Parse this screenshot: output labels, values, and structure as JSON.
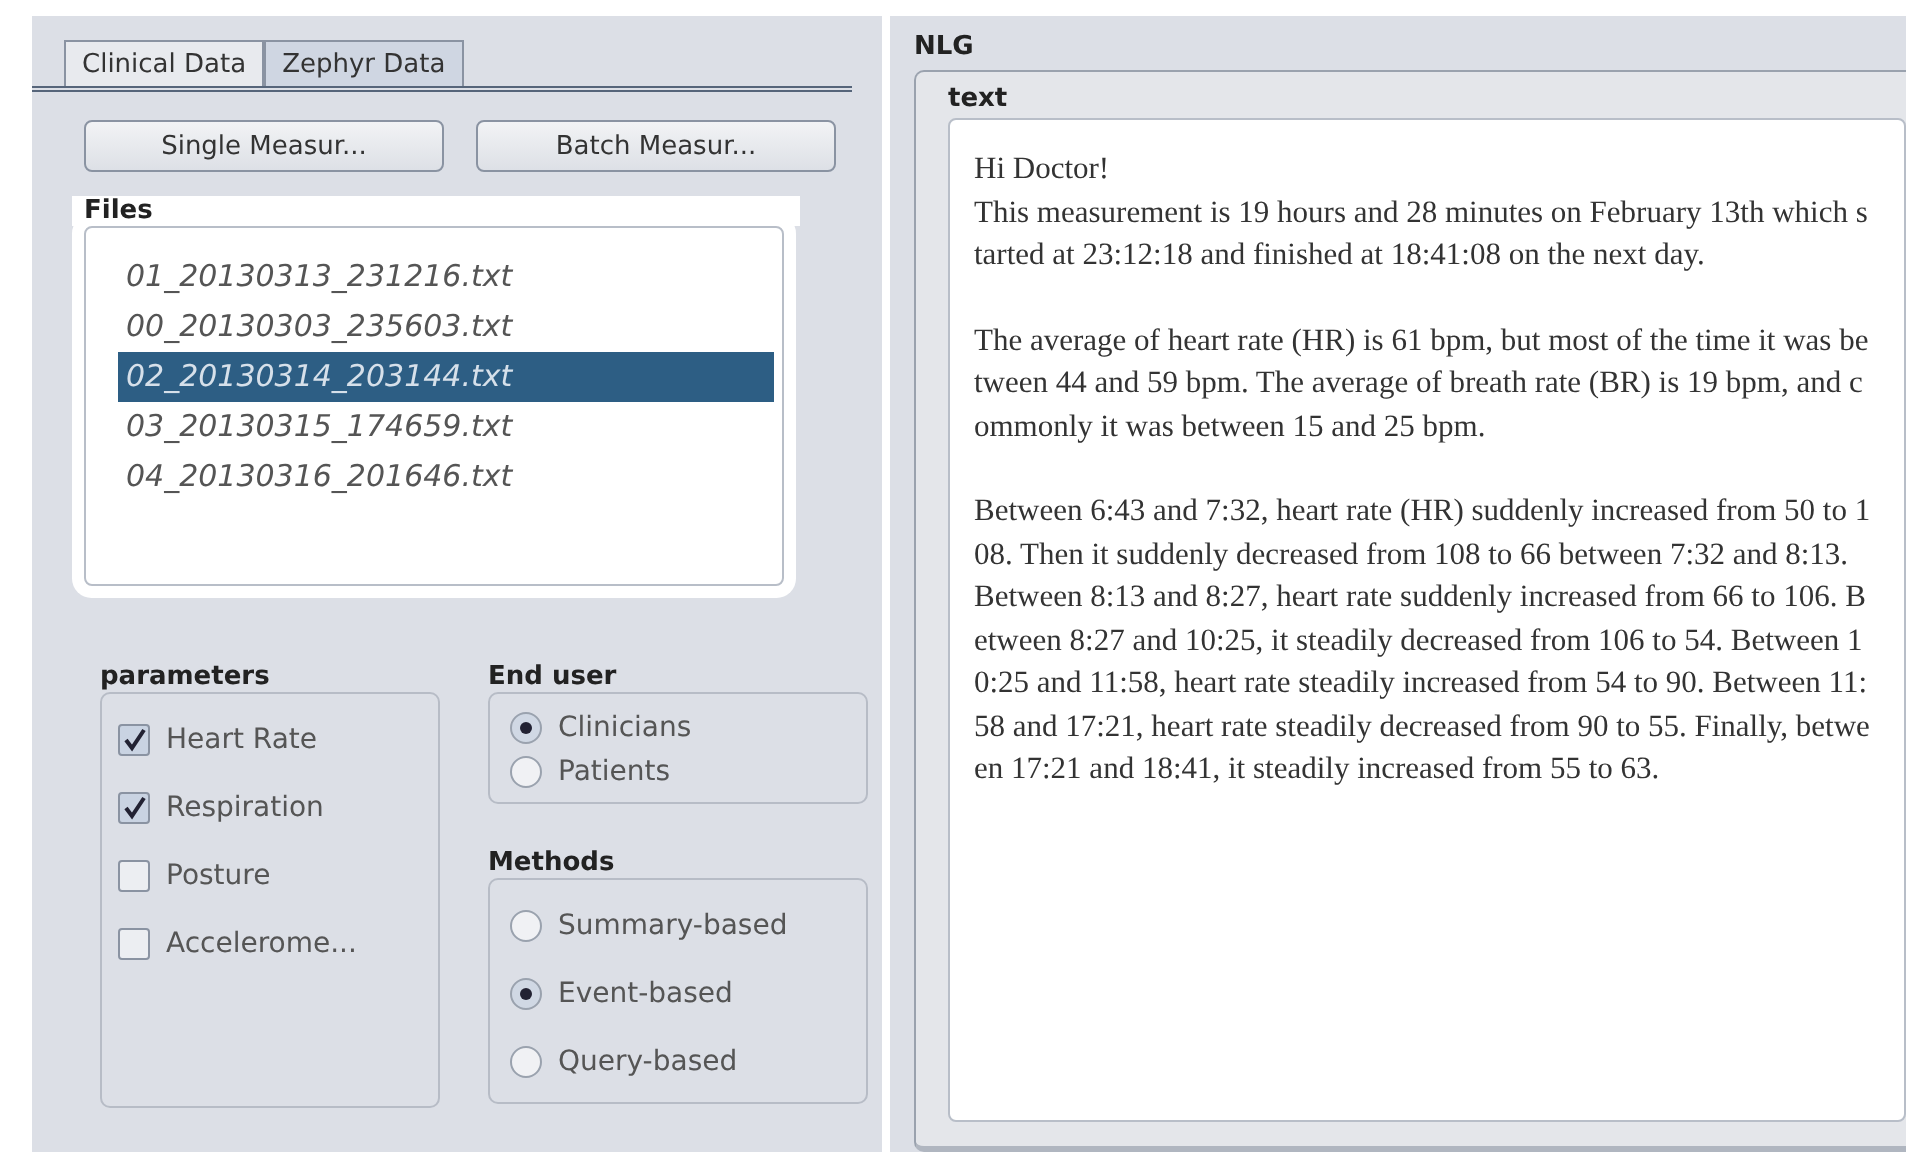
{
  "tabs": [
    {
      "label": "Clinical Data",
      "selected": false
    },
    {
      "label": "Zephyr Data",
      "selected": true
    }
  ],
  "buttons": [
    "Single Measur...",
    "Batch Measur..."
  ],
  "files": {
    "title": "Files",
    "items": [
      {
        "name": "01_20130313_231216.txt",
        "selected": false
      },
      {
        "name": "00_20130303_235603.txt",
        "selected": false
      },
      {
        "name": "02_20130314_203144.txt",
        "selected": true
      },
      {
        "name": "03_20130315_174659.txt",
        "selected": false
      },
      {
        "name": "04_20130316_201646.txt",
        "selected": false
      }
    ]
  },
  "parameters": {
    "title": "parameters",
    "items": [
      {
        "label": "Heart Rate",
        "checked": true
      },
      {
        "label": "Respiration",
        "checked": true
      },
      {
        "label": "Posture",
        "checked": false
      },
      {
        "label": "Accelerome...",
        "checked": false
      }
    ]
  },
  "end_user": {
    "title": "End user",
    "options": [
      {
        "label": "Clinicians",
        "selected": true
      },
      {
        "label": "Patients",
        "selected": false
      }
    ]
  },
  "methods": {
    "title": "Methods",
    "options": [
      {
        "label": "Summary-based",
        "selected": false
      },
      {
        "label": "Event-based",
        "selected": true
      },
      {
        "label": "Query-based",
        "selected": false
      }
    ]
  },
  "nlg": {
    "title": "NLG",
    "text_title": "text",
    "greeting": "Hi Doctor!",
    "paragraphs": [
      "This measurement is 19 hours and 28 minutes on February 13th which started at 23:12:18 and finished at 18:41:08 on the next day.",
      "The average of heart rate (HR) is 61 bpm, but most of the time it was between 44 and 59 bpm. The average of breath rate (BR) is 19 bpm, and commonly it was between 15 and 25 bpm.",
      "Between 6:43 and 7:32, heart rate (HR) suddenly increased from 50 to 108. Then it  suddenly decreased from 108 to 66 between 7:32 and 8:13. Between 8:13 and 8:27, heart rate suddenly increased from 66 to 106. Between 8:27 and 10:25, it steadily decreased from 106 to 54. Between 10:25 and 11:58, heart rate steadily increased from 54 to 90. Between 11:58 and 17:21, heart rate steadily decreased from 90 to 55. Finally, between 17:21 and 18:41, it steadily increased from 55 to 63."
    ]
  }
}
